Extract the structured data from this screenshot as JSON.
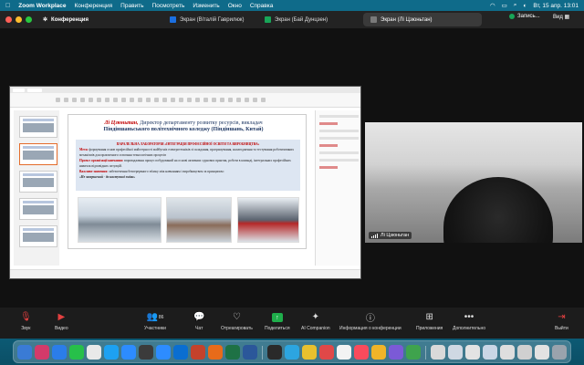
{
  "menubar": {
    "app_name": "Zoom Workplace",
    "menus": [
      "Конференция",
      "Править",
      "Посмотреть",
      "Изменить",
      "Окно",
      "Справка"
    ],
    "datetime": "Вт, 15 апр.  13:01"
  },
  "window": {
    "conference_label": "Конференция",
    "tabs": [
      {
        "label": "Экран (Віталій Гаврилюк)",
        "color": "#1b6fe0"
      },
      {
        "label": "Экран (Бай Дунцзен)",
        "color": "#18a558"
      },
      {
        "label": "Экран (Лі Цзюньтан)",
        "color": "#5b5b5b"
      }
    ],
    "recording_label": "Запись...",
    "view_label": "Вид"
  },
  "slide": {
    "title_name": "Лі Цзюньтан,",
    "title_rest": " Директор департаменту розвитку ресурсів, викладач",
    "title_line2": "Піндіншаньського політехнічного коледжу (Піндіншань, Китай)",
    "lab_title": "ПАРАЛЕЛЬНА ЛАБОРАТОРІЯ «ІНТЕГРАЦІЯ ПРОФЕСІЙНОЇ ОСВІТИ ТА ВИРОБНИЦТВА»",
    "goal_label": "Мета:",
    "goal_text": " формування основ професійної майстерності майбутніх електротехніків зі складання, програмування, налагодження та ",
    "goal_text2": "тестування роботизованих механізмів для практичного освоєння технологічних процесів",
    "project_label": "Проект організації навчання:",
    "project_text": " впровадження процес побудований на основі активних суднових практик, роботи в команді, інтегральних",
    "project_text2": "професійних навичок відповідних ситуацій.",
    "edu_label": "Важливе значення:",
    "edu_text": " забезпечення безперервного зв'язку між навчанням і виробництвом за принципом:",
    "motto": "«Не завершений - до наступної зміни»"
  },
  "video": {
    "participant_name": "Лі Цзюньтан"
  },
  "controls": {
    "items": [
      {
        "label": "Звук",
        "icon": "microphone-muted-icon"
      },
      {
        "label": "Видео",
        "icon": "video-off-icon"
      },
      {
        "label": "Участники",
        "icon": "participants-icon",
        "count": "86"
      },
      {
        "label": "Чат",
        "icon": "chat-icon"
      },
      {
        "label": "Отреагировать",
        "icon": "heart-icon"
      },
      {
        "label": "Поделиться",
        "icon": "share-icon"
      },
      {
        "label": "AI Companion",
        "icon": "ai-companion-icon"
      },
      {
        "label": "Информация о конференции",
        "icon": "info-icon"
      },
      {
        "label": "Приложения",
        "icon": "apps-icon"
      },
      {
        "label": "Дополнительно",
        "icon": "more-icon"
      },
      {
        "label": "Выйти",
        "icon": "leave-icon"
      }
    ]
  },
  "colors": {
    "menubar": "#0f6b8a",
    "share_active": "#1fae4b",
    "leave": "#e34040",
    "dock": "#0b4f66"
  }
}
